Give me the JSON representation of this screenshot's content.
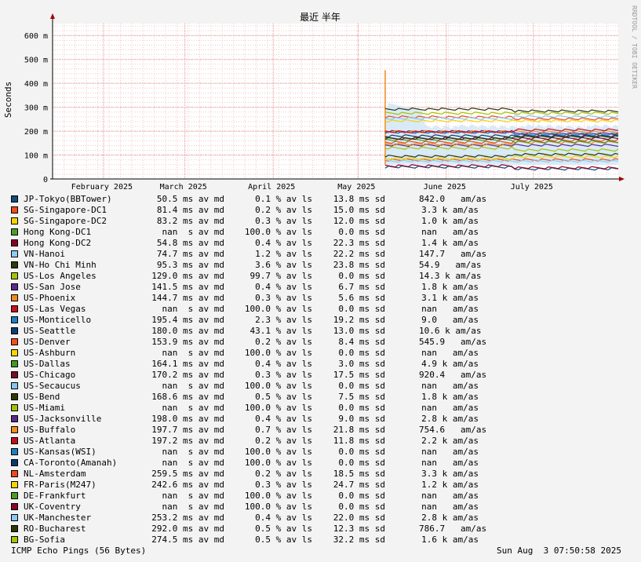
{
  "chart_data": {
    "type": "line",
    "title": "最近 半年",
    "ylabel": "Seconds",
    "watermark": "RRDTOOL / TOBI OETIKER",
    "ylim": [
      0,
      0.00065
    ],
    "y_ticks": [
      {
        "v": 0,
        "label": "0"
      },
      {
        "v": 100,
        "label": "100 m"
      },
      {
        "v": 200,
        "label": "200 m"
      },
      {
        "v": 300,
        "label": "300 m"
      },
      {
        "v": 400,
        "label": "400 m"
      },
      {
        "v": 500,
        "label": "500 m"
      },
      {
        "v": 600,
        "label": "600 m"
      }
    ],
    "x_ticks": [
      {
        "pos": 0.09,
        "label": "February 2025"
      },
      {
        "pos": 0.234,
        "label": "March 2025"
      },
      {
        "pos": 0.39,
        "label": "April 2025"
      },
      {
        "pos": 0.54,
        "label": "May 2025"
      },
      {
        "pos": 0.696,
        "label": "June 2025"
      },
      {
        "pos": 0.85,
        "label": "July 2025"
      }
    ],
    "data_start_frac": 0.588,
    "series": [
      {
        "name": "JP-Tokyo(BBTower)",
        "color": "#124c7a",
        "avg": "50.5 ms av md",
        "loss": "0.1 % av ls",
        "sd": "13.8 ms sd",
        "amas": "842.0   am/as",
        "level": 50
      },
      {
        "name": "SG-Singapore-DC1",
        "color": "#ee4d1e",
        "avg": "81.4 ms av md",
        "loss": "0.2 % av ls",
        "sd": "15.0 ms sd",
        "amas": "3.3 k am/as",
        "level": 80
      },
      {
        "name": "SG-Singapore-DC2",
        "color": "#f2d600",
        "avg": "83.2 ms av md",
        "loss": "0.3 % av ls",
        "sd": "12.0 ms sd",
        "amas": "1.0 k am/as",
        "level": 85
      },
      {
        "name": "Hong Kong-DC1",
        "color": "#4a9e28",
        "avg": "nan  s av md",
        "loss": "100.0 % av ls",
        "sd": "0.0 ms sd",
        "amas": "nan   am/as",
        "level": null
      },
      {
        "name": "Hong Kong-DC2",
        "color": "#8b0028",
        "avg": "54.8 ms av md",
        "loss": "0.4 % av ls",
        "sd": "22.3 ms sd",
        "amas": "1.4 k am/as",
        "level": 55
      },
      {
        "name": "VN-Hanoi",
        "color": "#8ecbf3",
        "avg": "74.7 ms av md",
        "loss": "1.2 % av ls",
        "sd": "22.2 ms sd",
        "amas": "147.7   am/as",
        "level": 75
      },
      {
        "name": "VN-Ho Chi Minh",
        "color": "#2b3a08",
        "avg": "95.3 ms av md",
        "loss": "3.6 % av ls",
        "sd": "23.8 ms sd",
        "amas": "54.9   am/as",
        "level": 95
      },
      {
        "name": "US-Los Angeles",
        "color": "#a8c400",
        "avg": "129.0 ms av md",
        "loss": "99.7 % av ls",
        "sd": "0.0 ms sd",
        "amas": "14.3 k am/as",
        "level": 129
      },
      {
        "name": "US-San Jose",
        "color": "#5b2a88",
        "avg": "141.5 ms av md",
        "loss": "0.4 % av ls",
        "sd": "6.7 ms sd",
        "amas": "1.8 k am/as",
        "level": 141
      },
      {
        "name": "US-Phoenix",
        "color": "#f08a1e",
        "avg": "144.7 ms av md",
        "loss": "0.3 % av ls",
        "sd": "5.6 ms sd",
        "amas": "3.1 k am/as",
        "level": 145
      },
      {
        "name": "US-Las Vegas",
        "color": "#c81020",
        "avg": "nan  s av md",
        "loss": "100.0 % av ls",
        "sd": "0.0 ms sd",
        "amas": "nan   am/as",
        "level": null
      },
      {
        "name": "US-Monticello",
        "color": "#1f7ec2",
        "avg": "195.4 ms av md",
        "loss": "2.3 % av ls",
        "sd": "19.2 ms sd",
        "amas": "9.0   am/as",
        "level": 195
      },
      {
        "name": "US-Seattle",
        "color": "#0e3e70",
        "avg": "180.0 ms av md",
        "loss": "43.1 % av ls",
        "sd": "13.0 ms sd",
        "amas": "10.6 k am/as",
        "level": 180
      },
      {
        "name": "US-Denver",
        "color": "#f0501e",
        "avg": "153.9 ms av md",
        "loss": "0.2 % av ls",
        "sd": "8.4 ms sd",
        "amas": "545.9   am/as",
        "level": 154
      },
      {
        "name": "US-Ashburn",
        "color": "#f5d800",
        "avg": "nan  s av md",
        "loss": "100.0 % av ls",
        "sd": "0.0 ms sd",
        "amas": "nan   am/as",
        "level": null
      },
      {
        "name": "US-Dallas",
        "color": "#3f9a24",
        "avg": "164.1 ms av md",
        "loss": "0.4 % av ls",
        "sd": "3.0 ms sd",
        "amas": "4.9 k am/as",
        "level": 164
      },
      {
        "name": "US-Chicago",
        "color": "#7a0a26",
        "avg": "170.2 ms av md",
        "loss": "0.3 % av ls",
        "sd": "17.5 ms sd",
        "amas": "920.4   am/as",
        "level": 170
      },
      {
        "name": "US-Secaucus",
        "color": "#86c6f0",
        "avg": "nan  s av md",
        "loss": "100.0 % av ls",
        "sd": "0.0 ms sd",
        "amas": "nan   am/as",
        "level": null
      },
      {
        "name": "US-Bend",
        "color": "#2d3a06",
        "avg": "168.6 ms av md",
        "loss": "0.5 % av ls",
        "sd": "7.5 ms sd",
        "amas": "1.8 k am/as",
        "level": 169
      },
      {
        "name": "US-Miami",
        "color": "#a2c000",
        "avg": "nan  s av md",
        "loss": "100.0 % av ls",
        "sd": "0.0 ms sd",
        "amas": "nan   am/as",
        "level": null
      },
      {
        "name": "US-Jacksonville",
        "color": "#5a2c86",
        "avg": "198.0 ms av md",
        "loss": "0.4 % av ls",
        "sd": "9.0 ms sd",
        "amas": "2.8 k am/as",
        "level": 198
      },
      {
        "name": "US-Buffalo",
        "color": "#f28c1a",
        "avg": "197.7 ms av md",
        "loss": "0.7 % av ls",
        "sd": "21.8 ms sd",
        "amas": "754.6   am/as",
        "level": 198
      },
      {
        "name": "US-Atlanta",
        "color": "#c0101e",
        "avg": "197.2 ms av md",
        "loss": "0.2 % av ls",
        "sd": "11.8 ms sd",
        "amas": "2.2 k am/as",
        "level": 197
      },
      {
        "name": "US-Kansas(WSI)",
        "color": "#1a80c4",
        "avg": "nan  s av md",
        "loss": "100.0 % av ls",
        "sd": "0.0 ms sd",
        "amas": "nan   am/as",
        "level": null
      },
      {
        "name": "CA-Toronto(Amanah)",
        "color": "#0a3a6c",
        "avg": "nan  s av md",
        "loss": "100.0 % av ls",
        "sd": "0.0 ms sd",
        "amas": "nan   am/as",
        "level": null
      },
      {
        "name": "NL-Amsterdam",
        "color": "#ee4a1c",
        "avg": "259.5 ms av md",
        "loss": "0.2 % av ls",
        "sd": "18.5 ms sd",
        "amas": "3.3 k am/as",
        "level": 259
      },
      {
        "name": "FR-Paris(M247)",
        "color": "#f4d400",
        "avg": "242.6 ms av md",
        "loss": "0.3 % av ls",
        "sd": "24.7 ms sd",
        "amas": "1.2 k am/as",
        "level": 243
      },
      {
        "name": "DE-Frankfurt",
        "color": "#4c9c26",
        "avg": "nan  s av md",
        "loss": "100.0 % av ls",
        "sd": "0.0 ms sd",
        "amas": "nan   am/as",
        "level": null
      },
      {
        "name": "UK-Coventry",
        "color": "#860826",
        "avg": "nan  s av md",
        "loss": "100.0 % av ls",
        "sd": "0.0 ms sd",
        "amas": "nan   am/as",
        "level": null
      },
      {
        "name": "UK-Manchester",
        "color": "#8ac8f2",
        "avg": "253.2 ms av md",
        "loss": "0.4 % av ls",
        "sd": "22.0 ms sd",
        "amas": "2.8 k am/as",
        "level": 253
      },
      {
        "name": "RO-Bucharest",
        "color": "#2a3806",
        "avg": "292.0 ms av md",
        "loss": "0.5 % av ls",
        "sd": "12.3 ms sd",
        "amas": "786.7   am/as",
        "level": 292
      },
      {
        "name": "BG-Sofia",
        "color": "#a6c200",
        "avg": "274.5 ms av md",
        "loss": "0.5 % av ls",
        "sd": "32.2 ms sd",
        "amas": "1.6 k am/as",
        "level": 275
      }
    ]
  },
  "footer": {
    "left": "ICMP Echo Pings (56 Bytes)",
    "right": "Sun Aug  3 07:50:58 2025"
  }
}
